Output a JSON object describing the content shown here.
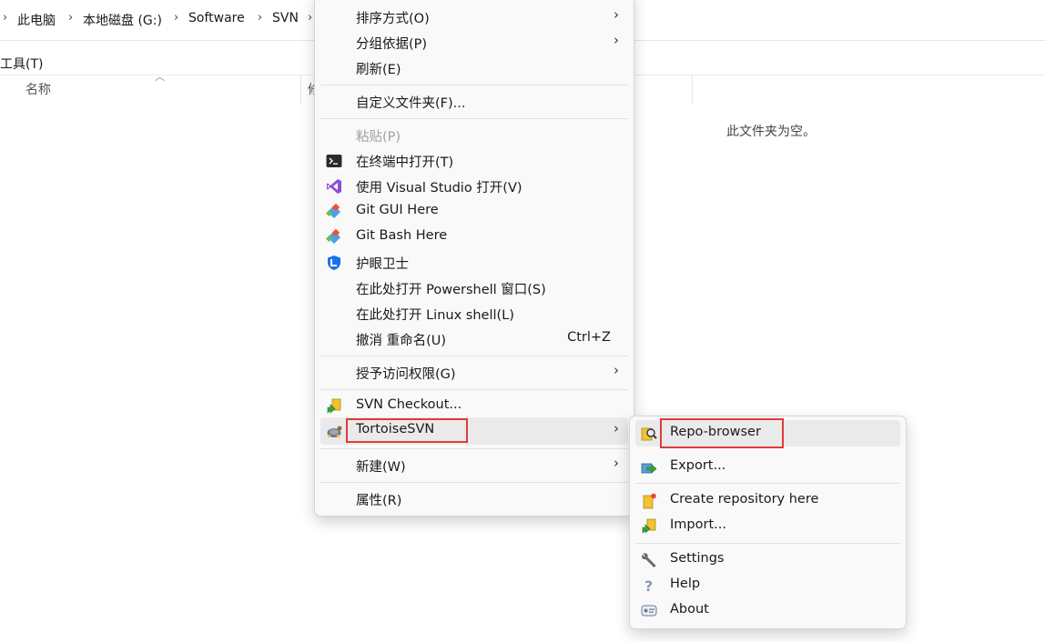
{
  "breadcrumb": {
    "items": [
      "此电脑",
      "本地磁盘 (G:)",
      "Software",
      "SVN"
    ],
    "separator": "›"
  },
  "menubar": {
    "tools": "工具(T)"
  },
  "columns": {
    "name": "名称",
    "truncated": "修"
  },
  "empty_message": "此文件夹为空。",
  "context_menu": {
    "sort_by": "排序方式(O)",
    "group_by": "分组依据(P)",
    "refresh": "刷新(E)",
    "customize_folder": "自定义文件夹(F)...",
    "paste": "粘贴(P)",
    "open_in_terminal": "在终端中打开(T)",
    "open_with_vs": "使用 Visual Studio 打开(V)",
    "git_gui": "Git GUI Here",
    "git_bash": "Git Bash Here",
    "eye_guard": "护眼卫士",
    "open_powershell": "在此处打开 Powershell 窗口(S)",
    "open_linux_shell": "在此处打开 Linux shell(L)",
    "undo_rename": "撤消 重命名(U)",
    "undo_shortcut": "Ctrl+Z",
    "grant_access": "授予访问权限(G)",
    "svn_checkout": "SVN Checkout...",
    "tortoise_svn": "TortoiseSVN",
    "new": "新建(W)",
    "properties": "属性(R)",
    "submenu_arrow": "›"
  },
  "tortoise_submenu": {
    "repo_browser": "Repo-browser",
    "export": "Export...",
    "create_repo": "Create repository here",
    "import": "Import...",
    "settings": "Settings",
    "help": "Help",
    "about": "About"
  },
  "colors": {
    "highlight_box": "#e03a3a",
    "hover": "#eaeaea",
    "menu_bg": "#f9f9f9"
  }
}
